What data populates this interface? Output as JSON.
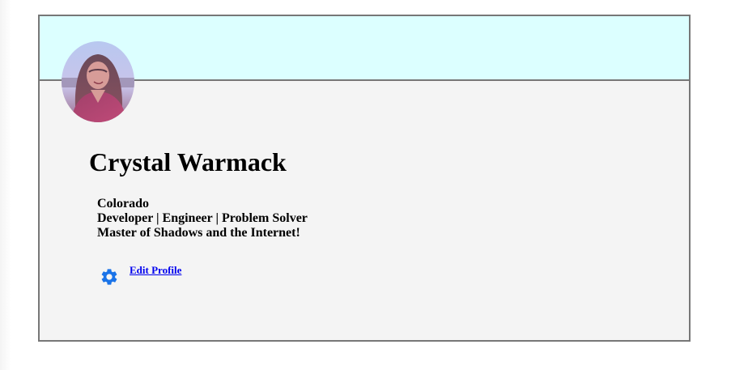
{
  "profile": {
    "name": "Crystal Warmack",
    "location": "Colorado",
    "tagline": "Developer | Engineer | Problem Solver",
    "bio": "Master of Shadows and the Internet!",
    "avatar_icon": "profile-photo",
    "edit_icon": "gear-icon",
    "edit_label": "Edit Profile"
  },
  "colors": {
    "banner": "#dcffff",
    "card": "#f4f4f4",
    "border": "#777777",
    "link": "#0000ee",
    "gear": "#1a73e8"
  }
}
